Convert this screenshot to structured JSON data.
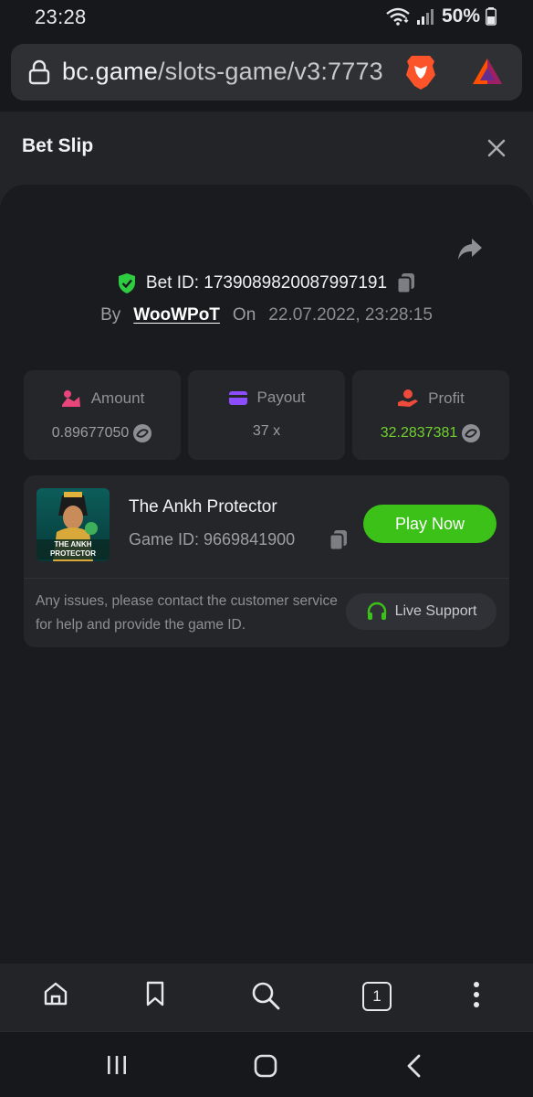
{
  "status": {
    "time": "23:28",
    "battery": "50%"
  },
  "browser": {
    "url_domain": "bc.game",
    "url_path": "/slots-game/v3:7773",
    "tab_count": "1"
  },
  "sheet": {
    "title": "Bet Slip"
  },
  "bet": {
    "id_label": "Bet ID: 1739089820087997191",
    "by_label": "By",
    "user": "WooWPoT",
    "on_label": "On",
    "datetime": "22.07.2022, 23:28:15"
  },
  "stats": {
    "amount_label": "Amount",
    "amount_value": "0.89677050",
    "payout_label": "Payout",
    "payout_value": "37 x",
    "profit_label": "Profit",
    "profit_value": "32.2837381"
  },
  "game": {
    "name": "The Ankh Protector",
    "id_label": "Game ID: 9669841900",
    "thumb_text": "THE ANKH PROTECTOR",
    "play_label": "Play Now",
    "issue_text": "Any issues, please contact the customer service for help and provide the game ID.",
    "support_label": "Live Support"
  },
  "colors": {
    "accent_green": "#3bc117",
    "profit_green": "#6fd12f",
    "shield_green": "#2ecc40",
    "amount_pink": "#e8457a",
    "payout_purple": "#8b4dff",
    "profit_red": "#ee4b3c"
  },
  "icons": [
    "lock-icon",
    "brave-lion-icon",
    "bat-triangle-icon",
    "close-icon",
    "share-icon",
    "shield-check-icon",
    "copy-icon",
    "coin-icon",
    "wallet-icon",
    "hand-coin-icon",
    "headset-icon",
    "home-icon",
    "bookmark-icon",
    "search-icon",
    "tabs-icon",
    "more-icon",
    "recents-icon",
    "home-circle-icon",
    "back-icon"
  ]
}
